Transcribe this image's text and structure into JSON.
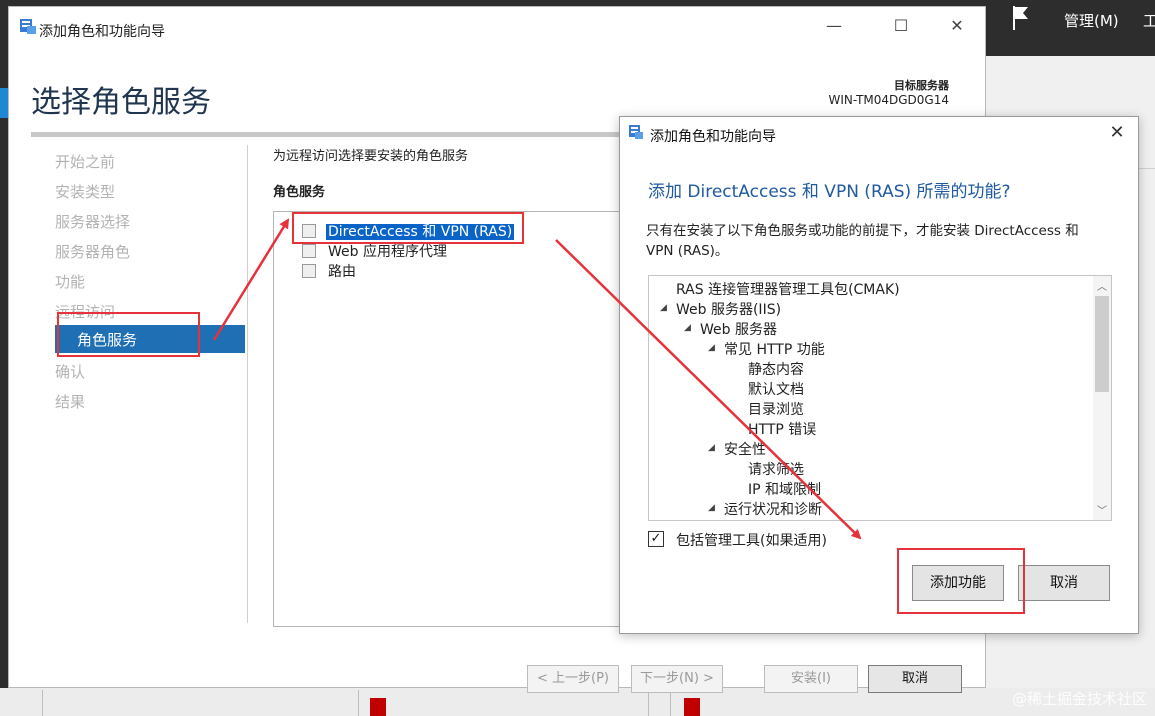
{
  "background": {
    "menu_manage": "管理(M)",
    "menu_tools": "工"
  },
  "wizard": {
    "title": "添加角色和功能向导",
    "heading": "选择角色服务",
    "target_label": "目标服务器",
    "target_value": "WIN-TM04DGD0G14",
    "nav": [
      "开始之前",
      "安装类型",
      "服务器选择",
      "服务器角色",
      "功能",
      "远程访问",
      "角色服务",
      "确认",
      "结果"
    ],
    "active_nav": "角色服务",
    "description": "为远程访问选择要安装的角色服务",
    "subheading": "角色服务",
    "roles": [
      "DirectAccess 和 VPN (RAS)",
      "Web 应用程序代理",
      "路由"
    ],
    "buttons": {
      "prev": "< 上一步(P)",
      "next": "下一步(N) >",
      "install": "安装(I)",
      "cancel": "取消"
    }
  },
  "dialog": {
    "title": "添加角色和功能向导",
    "heading": "添加 DirectAccess 和 VPN (RAS) 所需的功能?",
    "text": "只有在安装了以下角色服务或功能的前提下，才能安装 DirectAccess 和 VPN (RAS)。",
    "tree": [
      "RAS 连接管理器管理工具包(CMAK)",
      "Web 服务器(IIS)",
      "Web 服务器",
      "常见 HTTP 功能",
      "静态内容",
      "默认文档",
      "目录浏览",
      "HTTP 错误",
      "安全性",
      "请求筛选",
      "IP 和域限制",
      "运行状况和诊断"
    ],
    "checkbox_label": "包括管理工具(如果适用)",
    "checkbox_checked": true,
    "add_button": "添加功能",
    "cancel_button": "取消"
  },
  "watermark": "@稀土掘金技术社区",
  "colors": {
    "accent": "#1f6fb5",
    "annotation": "#e5323b",
    "heading": "#1f3550"
  }
}
